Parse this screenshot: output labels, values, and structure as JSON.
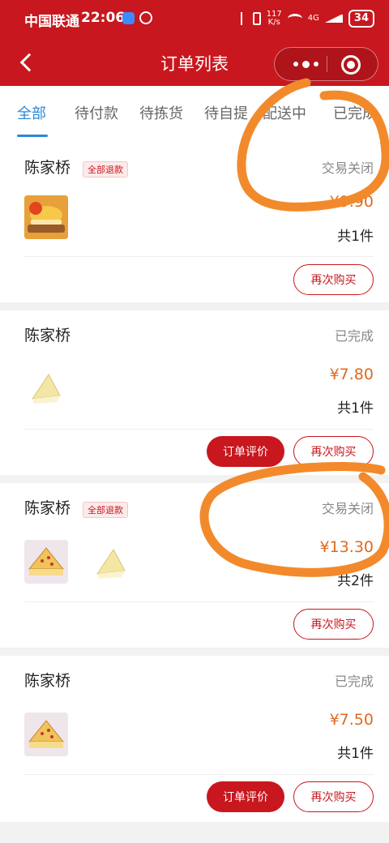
{
  "statusbar": {
    "carrier": "中国联通",
    "time": "22:06",
    "net_speed_value": "117",
    "net_speed_unit": "K/s",
    "network": "4G",
    "battery": "34"
  },
  "navbar": {
    "title": "订单列表"
  },
  "tabs": [
    {
      "label": "全部",
      "active": true
    },
    {
      "label": "待付款",
      "active": false
    },
    {
      "label": "待拣货",
      "active": false
    },
    {
      "label": "待自提",
      "active": false
    },
    {
      "label": "配送中",
      "active": false
    },
    {
      "label": "已完成",
      "active": false
    }
  ],
  "orders": [
    {
      "shop": "陈家桥",
      "badge": "全部退款",
      "status": "交易关闭",
      "price": "¥9.90",
      "count": "共1件",
      "buttons": {
        "rebuy": "再次购买"
      }
    },
    {
      "shop": "陈家桥",
      "status": "已完成",
      "price": "¥7.80",
      "count": "共1件",
      "buttons": {
        "review": "订单评价",
        "rebuy": "再次购买"
      }
    },
    {
      "shop": "陈家桥",
      "badge": "全部退款",
      "status": "交易关闭",
      "price": "¥13.30",
      "count": "共2件",
      "buttons": {
        "rebuy": "再次购买"
      }
    },
    {
      "shop": "陈家桥",
      "status": "已完成",
      "price": "¥7.50",
      "count": "共1件",
      "buttons": {
        "review": "订单评价",
        "rebuy": "再次购买"
      }
    }
  ],
  "colors": {
    "brand_red": "#c8171e",
    "price_orange": "#e06a1f",
    "tab_active_blue": "#2b89d6",
    "annotation_orange": "#f28a2c"
  }
}
